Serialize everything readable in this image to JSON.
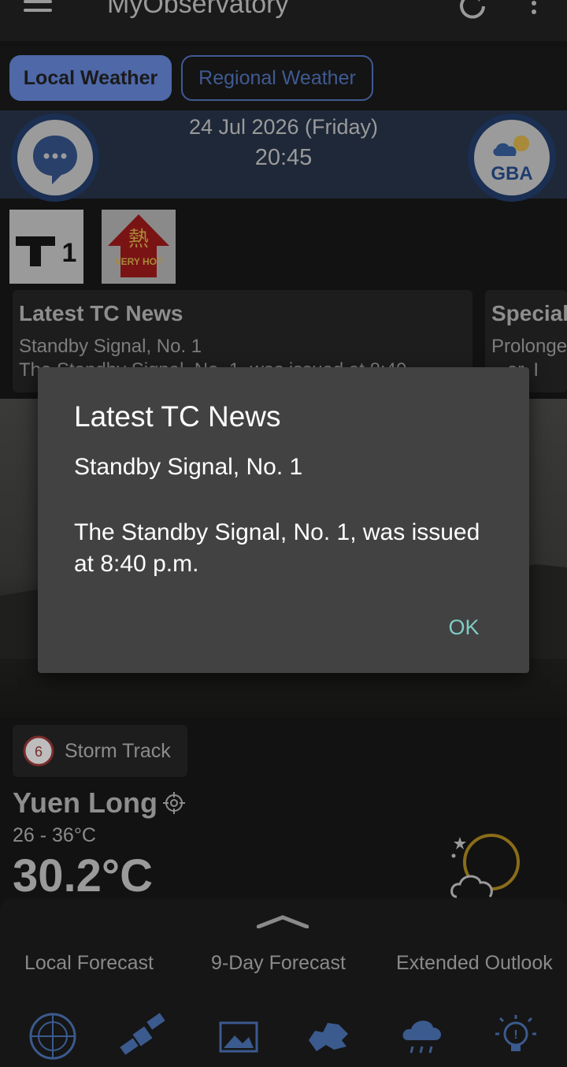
{
  "app": {
    "title": "MyObservatory"
  },
  "tabs": [
    {
      "label": "Local Weather",
      "active": true
    },
    {
      "label": "Regional Weather",
      "active": false
    }
  ],
  "header": {
    "date": "24 Jul 2026 (Friday)",
    "time": "20:45",
    "gba_label": "GBA"
  },
  "warnings": [
    {
      "name": "T1",
      "label": "1"
    },
    {
      "name": "very-hot",
      "label": "VERY HOT"
    }
  ],
  "news_cards": [
    {
      "title": "Latest TC News",
      "subtitle": "Standby Signal, No. 1",
      "body": "The Standby Signal, No. 1, was issued at 8:40"
    },
    {
      "title": "Special",
      "subtitle": "Prolonged",
      "body": "...er. I"
    }
  ],
  "storm_track": {
    "label": "Storm Track",
    "number": "6"
  },
  "location": {
    "name": "Yuen Long",
    "range": "26 - 36°C",
    "temperature": "30.2°C"
  },
  "forecast_tabs": [
    "Local Forecast",
    "9-Day Forecast",
    "Extended Outlook"
  ],
  "bottom_nav_icons": [
    "radar-icon",
    "satellite-icon",
    "photo-icon",
    "map-icon",
    "rain-icon",
    "tips-icon"
  ],
  "dialog": {
    "title": "Latest TC News",
    "subtitle": "Standby Signal, No. 1",
    "body": "The Standby Signal, No. 1, was issued at 8:40 p.m.",
    "ok_label": "OK"
  },
  "colors": {
    "accent": "#4e68a8",
    "dialog_bg": "#424242",
    "ok": "#80cbc4"
  }
}
